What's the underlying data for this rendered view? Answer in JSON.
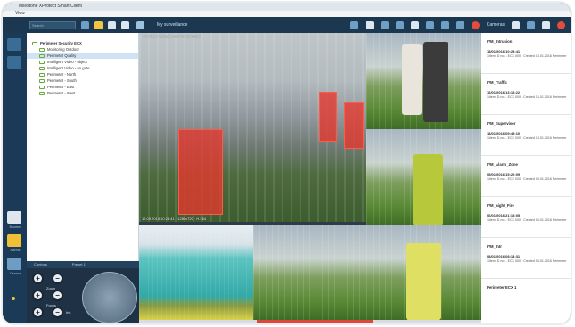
{
  "window": {
    "title": "Milestone XProtect Smart Client",
    "menu": "View"
  },
  "toolbar": {
    "search_placeholder": "Search",
    "view_title": "My surveillance",
    "cameras_label": "Cameras"
  },
  "colors": {
    "toolbar": "#1c3850",
    "detection": "#e7372d",
    "tree_selected": "#cfe3f5",
    "rail": "#1b3a57"
  },
  "rail": {
    "items": [
      {
        "label": "Browser"
      },
      {
        "label": "Alarms"
      },
      {
        "label": "Camera"
      }
    ]
  },
  "tree": {
    "items": [
      {
        "label": "Perimeter Security ECX"
      },
      {
        "label": "Monitoring Outdoor"
      },
      {
        "label": "Perimeter Quality"
      },
      {
        "label": "Intelligent Video - object"
      },
      {
        "label": "Intelligent Video - no gate"
      },
      {
        "label": "Perimeter - North"
      },
      {
        "label": "Perimeter - South"
      },
      {
        "label": "Perimeter - East"
      },
      {
        "label": "Perimeter - West"
      }
    ]
  },
  "ptz": {
    "title": "Controls",
    "preset": "Preset 1",
    "zoom_label": "Zoom",
    "focus_label": "Focus",
    "iris_label": "Iris"
  },
  "videos": {
    "main_label": "Perimeter Security ECX Fence North",
    "main_info": "12.09.2015 10:23:41 · 1280x720 · H.264"
  },
  "events": [
    {
      "name": "IVM_Intrusion",
      "time": "18/01/2016 10:23:41",
      "desc": "1 item ID no. - ECX 000 - Created 18.01.2016 Perimeter"
    },
    {
      "name": "IVM_Traffic",
      "time": "16/01/2016 13:18:22",
      "desc": "1 item ID no. - ECX 000 - Created 16.01.2016 Perimeter"
    },
    {
      "name": "IVM_Supervisor",
      "time": "14/01/2016 09:45:10",
      "desc": "1 item ID no. - ECX 000 - Created 14.01.2016 Perimeter"
    },
    {
      "name": "IVM_Alarm_Zone",
      "time": "09/01/2016 15:22:09",
      "desc": "1 item ID no. - ECX 000 - Created 09.01.2016 Perimeter"
    },
    {
      "name": "IVM_night_Fire",
      "time": "06/01/2016 21:18:05",
      "desc": "1 item ID no. - ECX 000 - Created 06.01.2016 Perimeter"
    },
    {
      "name": "IVM_Intr",
      "time": "04/01/2016 08:14:31",
      "desc": "1 item ID no. - ECX 000 - Created 04.01.2016 Perimeter"
    },
    {
      "name": "Perimeter ECX 1",
      "time": "",
      "desc": ""
    }
  ]
}
